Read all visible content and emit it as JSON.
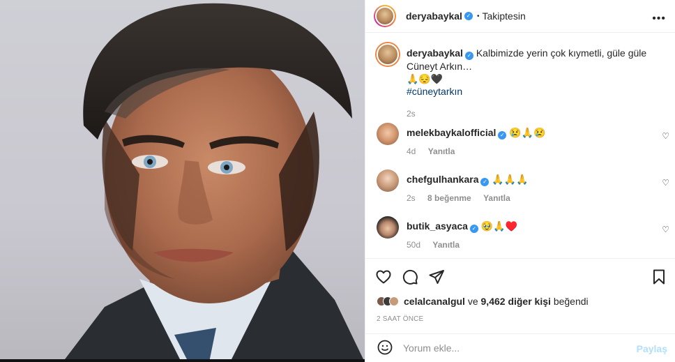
{
  "post": {
    "author": "deryabaykal",
    "follow_state": "Takiptesin",
    "caption": "Kalbimizde yerin çok kıymetli, güle güle Cüneyt Arkın…",
    "caption_emojis": "🙏😔🖤",
    "hashtag": "#cüneytarkın",
    "caption_time": "2s"
  },
  "comments": [
    {
      "username": "melekbaykalofficial",
      "text": "😢🙏😢",
      "time": "4d",
      "likes": "",
      "reply": "Yanıtla"
    },
    {
      "username": "chefgulhankara",
      "text": "🙏🙏🙏",
      "time": "2s",
      "likes": "8 beğenme",
      "reply": "Yanıtla"
    },
    {
      "username": "butik_asyaca",
      "text": "🥹🙏♥️",
      "time": "50d",
      "likes": "",
      "reply": "Yanıtla"
    }
  ],
  "likes": {
    "first_user": "celalcanalgul",
    "joiner": "ve",
    "count": "9,462 diğer kişi",
    "suffix": "beğendi"
  },
  "posted_time": "2 SAAT ÖNCE",
  "compose": {
    "placeholder": "Yorum ekle...",
    "share_label": "Paylaş"
  },
  "icons": {
    "more": "more-horizontal-icon",
    "like": "heart-icon",
    "comment": "comment-icon",
    "share": "send-icon",
    "save": "bookmark-icon",
    "emoji": "emoji-icon",
    "verified": "verified-badge-icon"
  },
  "colors": {
    "verified": "#3897f0",
    "link": "#00376b",
    "muted": "#8e8e8e",
    "share_disabled": "#b2dffc"
  }
}
